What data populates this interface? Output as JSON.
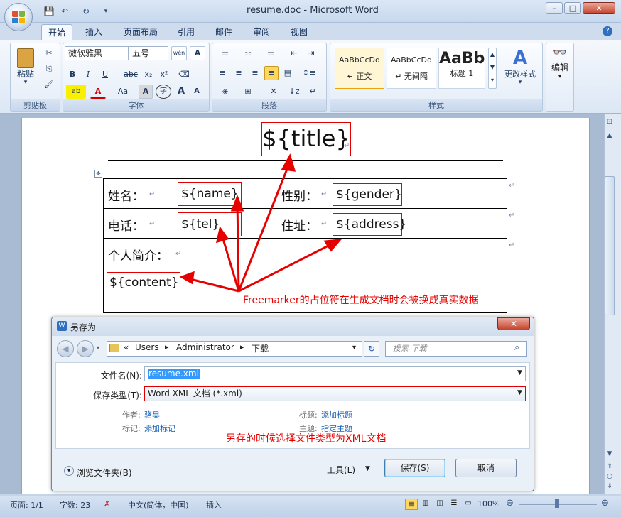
{
  "window": {
    "title": "resume.doc - Microsoft Word"
  },
  "tabs": [
    "开始",
    "插入",
    "页面布局",
    "引用",
    "邮件",
    "审阅",
    "视图"
  ],
  "ribbon": {
    "clipboard": {
      "label": "剪贴板",
      "paste": "粘贴"
    },
    "font": {
      "label": "字体",
      "font_name": "微软雅黑",
      "font_size": "五号",
      "bold": "B",
      "italic": "I",
      "underline": "U",
      "strike": "abc",
      "sub": "x₂",
      "sup": "x²",
      "wen": "wén",
      "A_box": "A",
      "A_color": "A",
      "Aa": "Aa",
      "A_shade": "A",
      "circle": "字",
      "grow": "A",
      "shrink": "A"
    },
    "paragraph": {
      "label": "段落"
    },
    "styles": {
      "label": "样式",
      "items": [
        {
          "preview": "AaBbCcDd",
          "name": "↵ 正文"
        },
        {
          "preview": "AaBbCcDd",
          "name": "↵ 无间隔"
        },
        {
          "preview": "AaBb",
          "name": "标题 1"
        }
      ],
      "change": "更改样式"
    },
    "editing": {
      "label": "编辑"
    }
  },
  "document": {
    "title_placeholder": "${title}",
    "row1": {
      "label1": "姓名：",
      "value1": "${name}",
      "label2": "性别：",
      "value2": "${gender}"
    },
    "row2": {
      "label1": "电话：",
      "value1": "${tel}",
      "label2": "住址：",
      "value2": "${address}"
    },
    "row3": {
      "label": "个人简介：",
      "value": "${content}"
    },
    "annotation_top": "Freemarker的占位符在生成文档时会被换成真实数据",
    "annotation_bottom": "另存的时候选择文件类型为XML文档"
  },
  "dialog": {
    "title": "另存为",
    "path": [
      "«",
      "Users",
      "▸",
      "Administrator",
      "▸",
      "下载"
    ],
    "search_placeholder": "搜索 下载",
    "filename_label": "文件名(N):",
    "filename_value": "resume.xml",
    "filetype_label": "保存类型(T):",
    "filetype_value": "Word XML 文档 (*.xml)",
    "author_label": "作者:",
    "author_value": "骆昊",
    "tags_label": "标记:",
    "tags_value": "添加标记",
    "title_label": "标题:",
    "title_value": "添加标题",
    "subject_label": "主题:",
    "subject_value": "指定主题",
    "browse": "浏览文件夹(B)",
    "tools": "工具(L)",
    "save": "保存(S)",
    "cancel": "取消"
  },
  "status": {
    "page": "页面: 1/1",
    "words": "字数: 23",
    "lang": "中文(简体，中国)",
    "mode": "插入",
    "zoom": "100%"
  }
}
